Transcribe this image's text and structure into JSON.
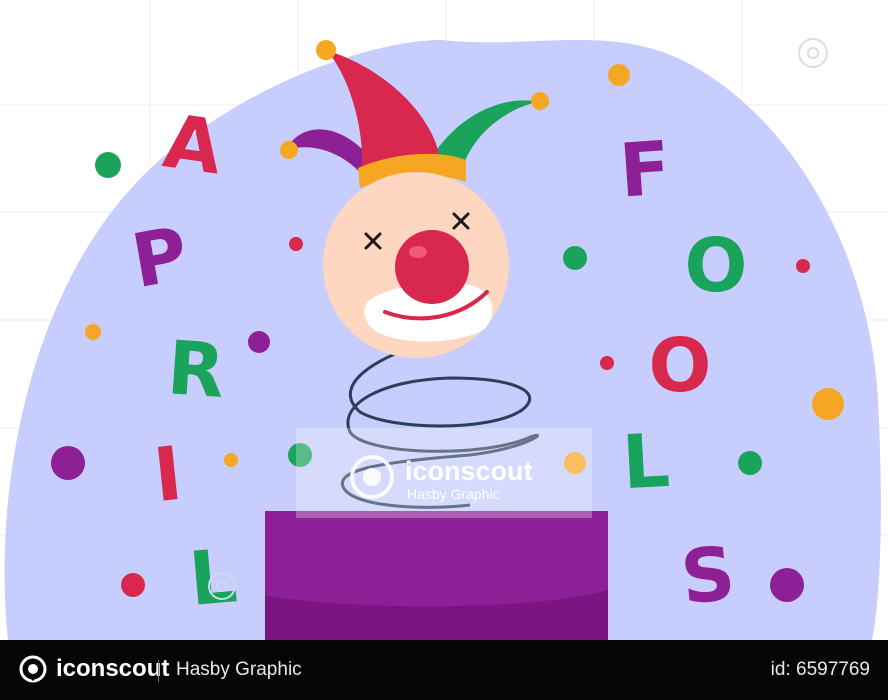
{
  "palette": {
    "backdrop": "#c7cdfc",
    "purple": "#8d1f97",
    "green": "#1aa35a",
    "red": "#d8284e",
    "orange": "#f5a623",
    "skin": "#ffd6bf",
    "nose": "#d8284e",
    "spring": "#2c3e5a"
  },
  "letters_left": [
    "A",
    "P",
    "R",
    "I",
    "L"
  ],
  "letters_right": [
    "F",
    "O",
    "O",
    "L",
    "S"
  ],
  "watermark": {
    "brand": "iconscout",
    "author": "Hasby Graphic"
  },
  "footer": {
    "brand": "iconscout",
    "author": "Hasby Graphic",
    "id_text": "id: 6597769"
  }
}
